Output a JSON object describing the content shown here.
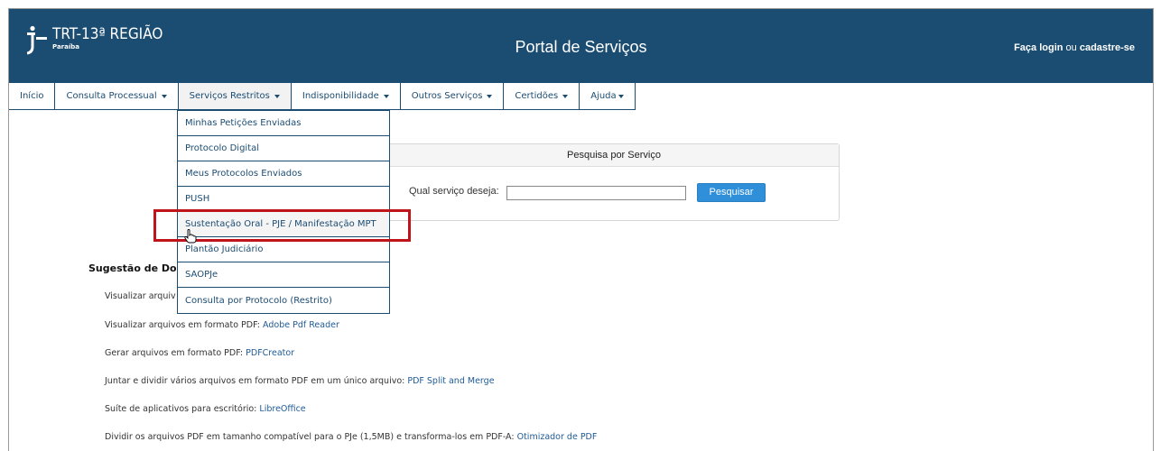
{
  "header": {
    "logo_title": "TRT-13ª REGIÃO",
    "logo_subtitle": "Paraíba",
    "portal_title": "Portal de Serviços",
    "login_label": "Faça login",
    "login_separator": " ou ",
    "register_label": "cadastre-se",
    "bg_color": "#1b4c72"
  },
  "nav": {
    "items": [
      {
        "label": "Início",
        "has_caret": false
      },
      {
        "label": "Consulta Processual",
        "has_caret": true
      },
      {
        "label": "Serviços Restritos",
        "has_caret": true
      },
      {
        "label": "Indisponibilidade",
        "has_caret": true
      },
      {
        "label": "Outros Serviços",
        "has_caret": true
      },
      {
        "label": "Certidões",
        "has_caret": true
      },
      {
        "label": "Ajuda",
        "has_caret": true
      }
    ]
  },
  "dropdown": {
    "items": [
      "Minhas Petições Enviadas",
      "Protocolo Digital",
      "Meus Protocolos Enviados",
      "PUSH",
      "Sustentação Oral - PJE / Manifestação MPT",
      "Plantão Judiciário",
      "SAOPJe",
      "Consulta por Protocolo (Restrito)"
    ],
    "highlighted_index": 4,
    "highlight_color": "#c0141b"
  },
  "search": {
    "title": "Pesquisa por Serviço",
    "label": "Qual serviço deseja:",
    "input_value": "",
    "button_label": "Pesquisar",
    "button_color": "#2f8fd8"
  },
  "suggestions": {
    "title": "Sugestão de Do",
    "lines": [
      {
        "text": "Visualizar arquiv",
        "link": ""
      },
      {
        "text": "Visualizar arquivos em formato PDF: ",
        "link": "Adobe Pdf Reader"
      },
      {
        "text": "Gerar arquivos em formato PDF: ",
        "link": "PDFCreator"
      },
      {
        "text": "Juntar e dividir vários arquivos em formato PDF em um único arquivo: ",
        "link": "PDF Split and Merge"
      },
      {
        "text": "Suíte de aplicativos para escritório: ",
        "link": "LibreOffice"
      },
      {
        "text": "Dividir os arquivos PDF em tamanho compatível para o PJe (1,5MB) e transforma-los em PDF-A: ",
        "link": "Otimizador de PDF"
      }
    ]
  }
}
